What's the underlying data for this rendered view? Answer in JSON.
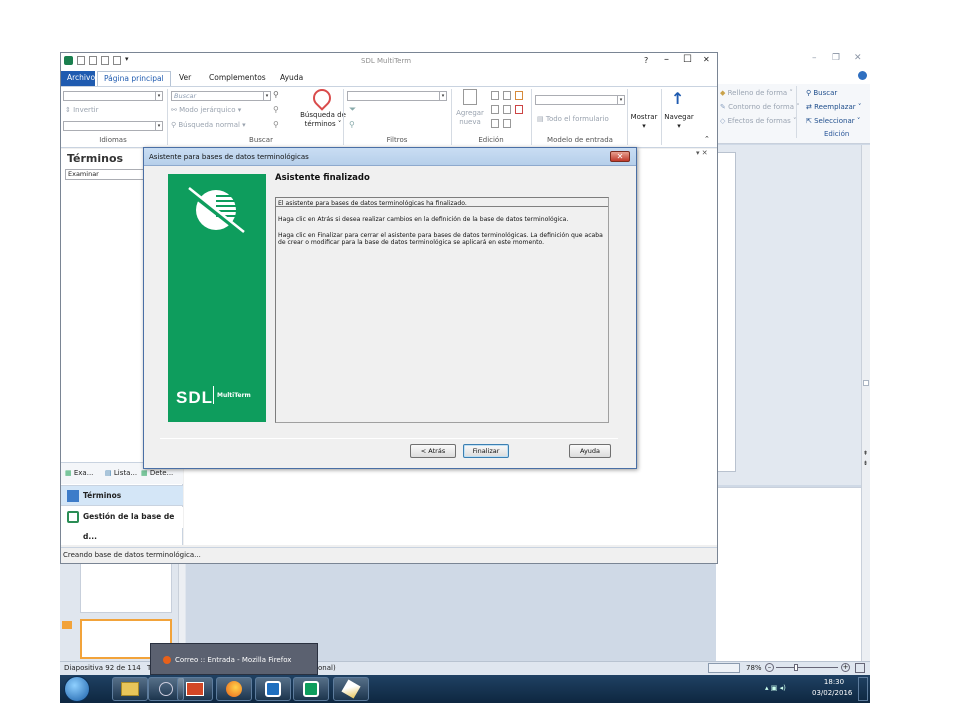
{
  "ppt": {
    "ribbon_items": [
      {
        "icon": "paint-bucket-icon",
        "label": "Relleno de forma ˅",
        "enabled": false
      },
      {
        "icon": "pen-outline-icon",
        "label": "Contorno de forma ˅",
        "enabled": false
      },
      {
        "icon": "effects-icon",
        "label": "Efectos de formas ˅",
        "enabled": false
      },
      {
        "icon": "binoculars-icon",
        "label": "Buscar",
        "enabled": true
      },
      {
        "icon": "replace-icon",
        "label": "Reemplazar ˅",
        "enabled": true
      },
      {
        "icon": "cursor-select-icon",
        "label": "Seleccionar ˅",
        "enabled": true
      }
    ],
    "group_label": "Edición",
    "window_controls": {
      "minimize": "–",
      "restore": "❐",
      "close": "✕"
    },
    "status_left": "Diapositiva 92 de 114",
    "status_mid": "T",
    "status_mid2": "onal)",
    "zoom": "78%",
    "zoom_minus": "–",
    "zoom_plus": "+"
  },
  "taskbar": {
    "popup_label": "Correo :: Entrada - Mozilla Firefox",
    "time": "18:30",
    "date": "03/02/2016",
    "apps": [
      "start-orb-icon",
      "explorer-folder-icon",
      "app-icon",
      "powerpoint-icon",
      "firefox-icon",
      "multiterm-icon",
      "multiterm-icon-2",
      "paint-icon"
    ]
  },
  "multiterm": {
    "title": "SDL MultiTerm",
    "quick_access_icons": [
      "app-logo-icon",
      "new-icon",
      "save-icon",
      "print-icon",
      "undo-icon",
      "customize-icon"
    ],
    "window_controls": {
      "help": "?",
      "minimize": "–",
      "maximize": "☐",
      "close": "✕"
    },
    "tabs": [
      "Archivo",
      "Página principal",
      "Ver",
      "Complementos",
      "Ayuda"
    ],
    "ribbon": {
      "search_placeholder": "Buscar",
      "invert": "Invertir",
      "modo_jerarquico": "Modo jerárquico",
      "busqueda_normal": "Búsqueda normal",
      "busqueda_de_terminos": "Búsqueda de",
      "busqueda_de_terminos_2": "términos ˅",
      "agregar": "Agregar",
      "nueva": "nueva",
      "todo_el_formulario": "Todo el formulario",
      "mostrar": "Mostrar",
      "navegar": "Navegar",
      "groups": [
        "Idiomas",
        "Buscar",
        "Filtros",
        "Edición",
        "Modelo de entrada"
      ]
    },
    "left_panel": {
      "title": "Términos",
      "search_value": "Examinar",
      "tabs": [
        "Exa...",
        "Lista...",
        "Dete..."
      ],
      "nav": [
        "Términos",
        "Gestión de la base de d..."
      ]
    },
    "status": "Creando base de datos terminológica..."
  },
  "wizard": {
    "title": "Asistente para bases de datos terminológicas",
    "close": "✕",
    "heading": "Asistente finalizado",
    "paragraphs": [
      "El asistente para bases de datos terminológicas ha finalizado.",
      "Haga clic en Atrás si desea realizar cambios en la definición de la base de datos terminológica.",
      "Haga clic en Finalizar para cerrar el asistente para bases de datos terminológicas. La definición que acaba de crear o modificar para la base de datos terminológica se aplicará en este momento."
    ],
    "brand_logo_text": "SDL",
    "brand_product": "MultiTerm",
    "buttons": {
      "back": "< Atrás",
      "finish": "Finalizar",
      "help": "Ayuda"
    },
    "brand_color": "#0e9d5d"
  }
}
